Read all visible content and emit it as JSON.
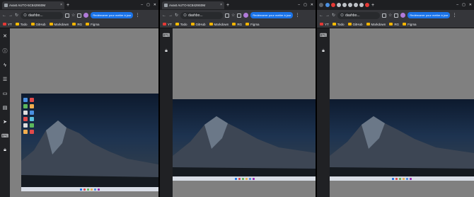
{
  "windows": [
    {
      "tab_title": "Avast AUTO-5C8429S0M",
      "address": "dashbo...",
      "update_button": "Redémarrer pour mettre à jour",
      "bookmarks": [
        {
          "label": "YT",
          "color": "#e53935"
        },
        {
          "label": "Todo",
          "color": "#fbbc04"
        },
        {
          "label": "GitHub",
          "color": "#f4b400"
        },
        {
          "label": "Markdown",
          "color": "#f4b400"
        },
        {
          "label": "RG",
          "color": "#f4b400"
        },
        {
          "label": "Figma",
          "color": "#f4b400"
        }
      ]
    },
    {
      "tab_title": "Avast AUTO-5C8429S0M",
      "address": "dashbo...",
      "update_button": "Redémarrer pour mettre à jour",
      "bookmarks": [
        {
          "label": "YT",
          "color": "#e53935"
        },
        {
          "label": "Todo",
          "color": "#fbbc04"
        },
        {
          "label": "GitHub",
          "color": "#f4b400"
        },
        {
          "label": "Markdown",
          "color": "#f4b400"
        },
        {
          "label": "RG",
          "color": "#f4b400"
        },
        {
          "label": "Figma",
          "color": "#f4b400"
        }
      ]
    },
    {
      "tab_title": "",
      "address": "dashbo...",
      "update_button": "Redémarrer pour mettre à jour",
      "bookmarks": [
        {
          "label": "YT",
          "color": "#e53935"
        },
        {
          "label": "Todo",
          "color": "#fbbc04"
        },
        {
          "label": "GitHub",
          "color": "#f4b400"
        },
        {
          "label": "Markdown",
          "color": "#f4b400"
        },
        {
          "label": "RG",
          "color": "#f4b400"
        },
        {
          "label": "Figma",
          "color": "#f4b400"
        }
      ]
    }
  ],
  "icons": {
    "window_controls": [
      "minimize-icon",
      "maximize-icon",
      "close-icon"
    ],
    "remote_sidebar": [
      "close-icon",
      "info-icon",
      "lightning-icon",
      "settings-icon",
      "monitor-icon",
      "file-icon",
      "pointer-icon",
      "keyboard-icon",
      "lock-icon"
    ],
    "remote_sidebar_compact": [
      "keyboard-icon",
      "lock-icon"
    ]
  },
  "colors": {
    "accent": "#1a73e8",
    "viewport_bg": "#808080",
    "toolbar_bg": "#35363a"
  }
}
